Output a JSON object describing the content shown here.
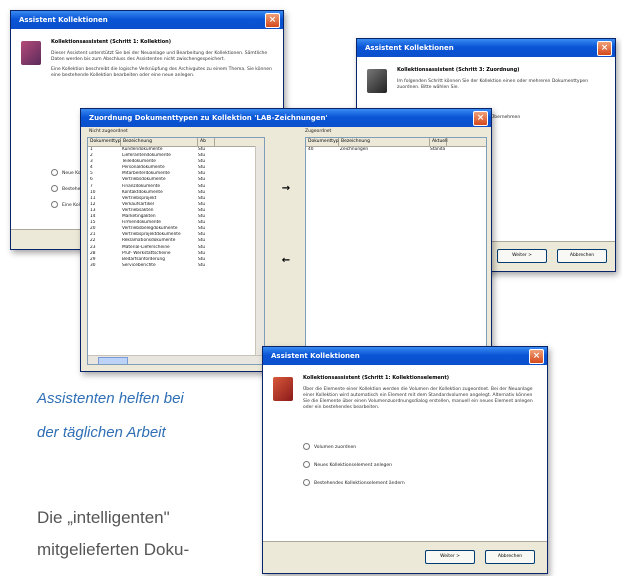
{
  "window1": {
    "title": "Assistent Kollektionen",
    "header_title": "Kollektionsassistent (Schritt 1: Kollektion)",
    "body": "Dieser Assistent unterstützt Sie bei der Neuanlage und Bearbeitung der Kollektionen. Sämtliche Daten werden bis zum Abschluss des Assistenten nicht zwischengespeichert.",
    "body2": "Eine Kollektion beschreibt die logische Verknüpfung des Archivgutes zu einem Thema. Sie können eine bestehende Kollektion bearbeiten oder eine neue anlegen.",
    "options": [
      "Neue Kollektion anlegen",
      "Bestehende Kollektion bearbeiten",
      "Eine Kollektion löschen"
    ]
  },
  "window2": {
    "title": "Assistent Kollektionen",
    "header_title": "Kollektionsassistent (Schritt 3: Zuordnung)",
    "body": "Im folgenden Schritt können Sie der Kollektion einen oder mehreren Dokumenttypen zuordnen. Bitte wählen Sie.",
    "side_text": "Übernehmen",
    "btn_next": "Weiter >",
    "btn_cancel": "Abbrechen"
  },
  "window3": {
    "title": "Zuordnung Dokumenttypen zu Kollektion 'LAB-Zeichnungen'",
    "left_label": "Nicht zugeordnet",
    "right_label": "Zugeordnet",
    "columns": [
      "Dokumenttyp",
      "Bezeichnung",
      "Ab"
    ],
    "right_columns": [
      "Dokumenttyp",
      "Bezeichnung",
      "Aktuell"
    ],
    "rows": [
      [
        "1",
        "Kundendokumente",
        "Stu"
      ],
      [
        "2",
        "Lieferantendokumente",
        "Stu"
      ],
      [
        "3",
        "Teiledokumente",
        "Stu"
      ],
      [
        "4",
        "Personaldokumente",
        "Stu"
      ],
      [
        "5",
        "Mitarbeiterdokumente",
        "Stu"
      ],
      [
        "6",
        "Vertriebsdokumente",
        "Stu"
      ],
      [
        "7",
        "Finanzdokumente",
        "Stu"
      ],
      [
        "10",
        "Kontaktdokumente",
        "Stu"
      ],
      [
        "11",
        "Vertriebsprojekt",
        "Stu"
      ],
      [
        "12",
        "Verkaufsartikel",
        "Stu"
      ],
      [
        "13",
        "Vertriebsakten",
        "Stu"
      ],
      [
        "14",
        "Marketingakten",
        "Stu"
      ],
      [
        "15",
        "Firmendokumente",
        "Stu"
      ],
      [
        "20",
        "Vertriebsbelegdokumente",
        "Stu"
      ],
      [
        "21",
        "Vertriebsprojektdokumente",
        "Stu"
      ],
      [
        "22",
        "Reklamationsdokumente",
        "Stu"
      ],
      [
        "23",
        "Material-Lieferscheine",
        "Stu"
      ],
      [
        "28",
        "Prüf- Werkstattscheine",
        "Stu"
      ],
      [
        "29",
        "Bedarfsanforderung",
        "Stu"
      ],
      [
        "30",
        "Serviceberichte",
        "Stu"
      ]
    ],
    "right_rows": [
      [
        "40",
        "Zeichnungen",
        "Standa"
      ]
    ],
    "arrow_right": "→",
    "arrow_left": "←"
  },
  "window4": {
    "title": "Assistent Kollektionen",
    "header_title": "Kollektionsassistent (Schritt 1: Kollektionselement)",
    "body": "Über die Elemente einer Kollektion werden die Volumen der Kollektion zugeordnet. Bei der Neuanlage einer Kollektion wird automatisch ein Element mit dem Standardvolumen angelegt. Alternativ können Sie die Elemente über einen Volumenzuordnungsdialog erstellen, manuell ein neues Element anlegen oder ein bestehendes bearbeiten.",
    "options": [
      "Volumen zuordnen",
      "Neues Kollektionselement anlegen",
      "Bestehendes Kollektionselement ändern"
    ],
    "btn_next": "Weiter >",
    "btn_cancel": "Abbrechen"
  },
  "caption": [
    "Assistenten helfen bei",
    "der täglichen Arbeit"
  ],
  "paragraph": [
    "Die „intelligenten\"",
    "mitgelieferten Doku-"
  ]
}
